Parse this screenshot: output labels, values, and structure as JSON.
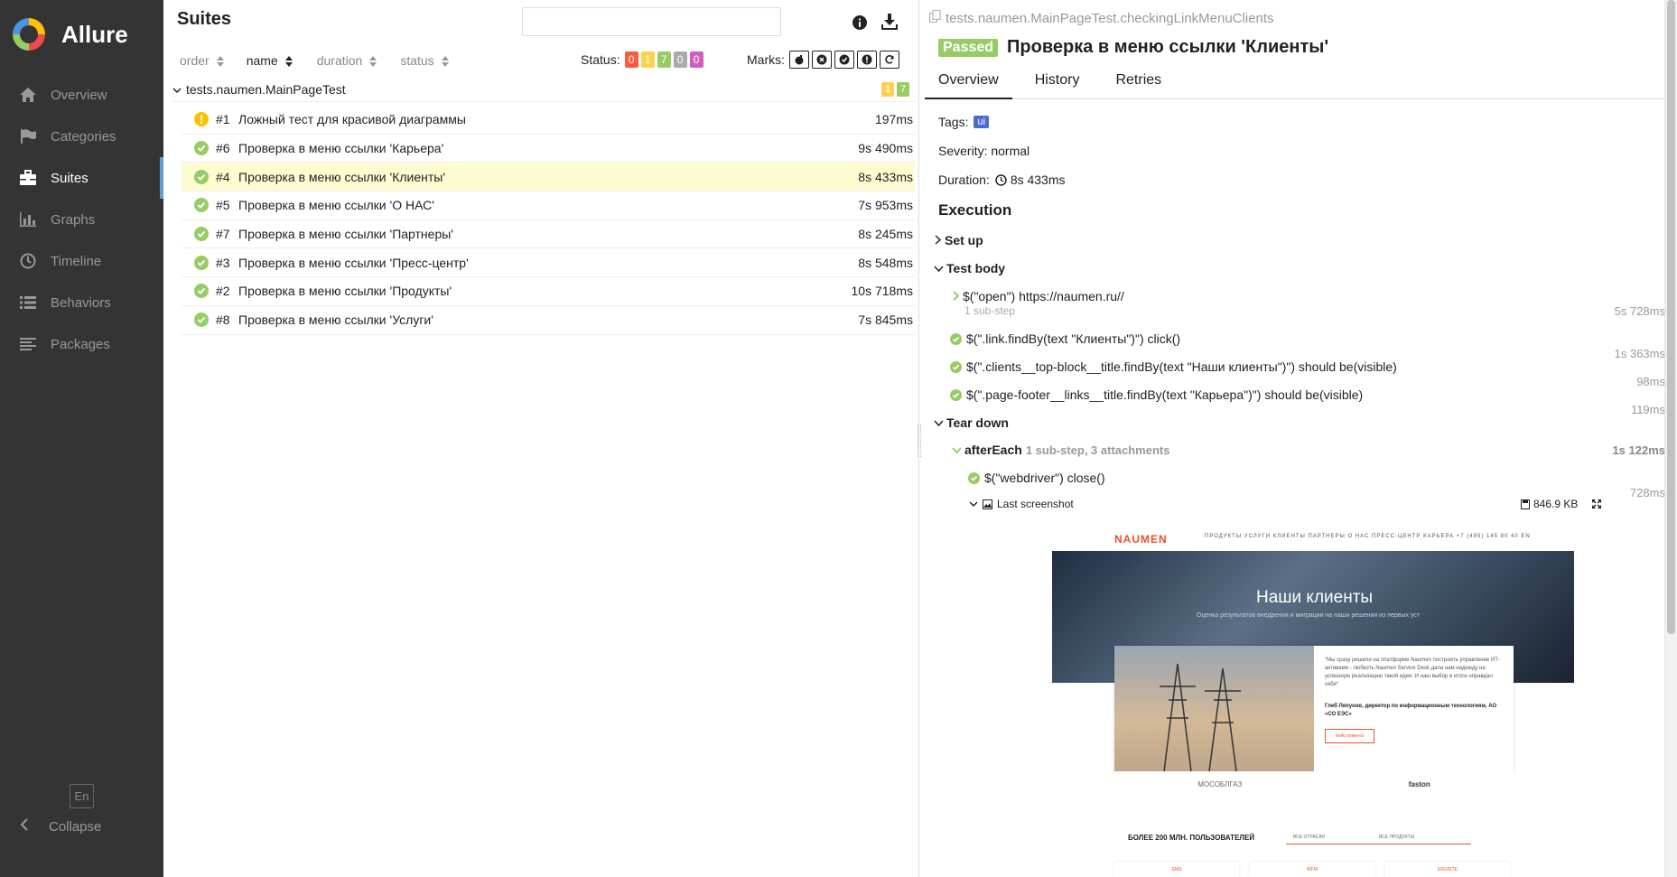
{
  "app": {
    "name": "Allure"
  },
  "sidebar": {
    "items": [
      {
        "label": "Overview",
        "icon": "home-icon",
        "active": false
      },
      {
        "label": "Categories",
        "icon": "flag-icon",
        "active": false
      },
      {
        "label": "Suites",
        "icon": "briefcase-icon",
        "active": true
      },
      {
        "label": "Graphs",
        "icon": "bar-chart-icon",
        "active": false
      },
      {
        "label": "Timeline",
        "icon": "clock-icon",
        "active": false
      },
      {
        "label": "Behaviors",
        "icon": "list-icon",
        "active": false
      },
      {
        "label": "Packages",
        "icon": "align-left-icon",
        "active": false
      }
    ],
    "language": "En",
    "collapse_label": "Collapse"
  },
  "suites": {
    "title": "Suites",
    "search": {
      "value": "",
      "placeholder": ""
    },
    "sort": {
      "order": "order",
      "name": "name",
      "duration": "duration",
      "status": "status"
    },
    "status_label": "Status:",
    "status_counts": [
      {
        "value": "0",
        "color": "#fd5a3e"
      },
      {
        "value": "1",
        "color": "#ffd050"
      },
      {
        "value": "7",
        "color": "#97cc64"
      },
      {
        "value": "0",
        "color": "#aaaaaa"
      },
      {
        "value": "0",
        "color": "#d35ebe"
      }
    ],
    "marks_label": "Marks:",
    "group": {
      "name": "tests.naumen.MainPageTest",
      "broken": "1",
      "passed": "7"
    },
    "tests": [
      {
        "num": "#1",
        "name": "Ложный тест для красивой диаграммы",
        "duration": "197ms",
        "status": "broken"
      },
      {
        "num": "#6",
        "name": "Проверка в меню ссылки 'Карьера'",
        "duration": "9s 490ms",
        "status": "passed"
      },
      {
        "num": "#4",
        "name": "Проверка в меню ссылки 'Клиенты'",
        "duration": "8s 433ms",
        "status": "passed",
        "selected": true
      },
      {
        "num": "#5",
        "name": "Проверка в меню ссылки 'О НАС'",
        "duration": "7s 953ms",
        "status": "passed"
      },
      {
        "num": "#7",
        "name": "Проверка в меню ссылки 'Партнеры'",
        "duration": "8s 245ms",
        "status": "passed"
      },
      {
        "num": "#3",
        "name": "Проверка в меню ссылки 'Пресс-центр'",
        "duration": "8s 548ms",
        "status": "passed"
      },
      {
        "num": "#2",
        "name": "Проверка в меню ссылки 'Продукты'",
        "duration": "10s 718ms",
        "status": "passed"
      },
      {
        "num": "#8",
        "name": "Проверка в меню ссылки 'Услуги'",
        "duration": "7s 845ms",
        "status": "passed"
      }
    ]
  },
  "details": {
    "full_name": "tests.naumen.MainPageTest.checkingLinkMenuClients",
    "status": "Passed",
    "title": "Проверка в меню ссылки 'Клиенты'",
    "tabs": [
      "Overview",
      "History",
      "Retries"
    ],
    "tags_label": "Tags:",
    "tag": "ui",
    "severity": "Severity: normal",
    "duration_label": "Duration:",
    "duration": "8s 433ms",
    "execution": "Execution",
    "setup": "Set up",
    "test_body": "Test body",
    "steps": [
      {
        "name": "$(\"open\") https://naumen.ru//",
        "sub": "1 sub-step",
        "time": "5s 728ms"
      },
      {
        "name": "$(\".link.findBy(text \"Клиенты\")\") click()",
        "time": "1s 363ms"
      },
      {
        "name": "$(\".clients__top-block__title.findBy(text \"Наши клиенты\")\") should be(visible)",
        "time": "98ms"
      },
      {
        "name": "$(\".page-footer__links__title.findBy(text \"Карьера\")\") should be(visible)",
        "time": "119ms"
      }
    ],
    "teardown": "Tear down",
    "after_each": {
      "name": "afterEach",
      "meta": "1 sub-step, 3 attachments",
      "time": "1s 122ms"
    },
    "webdriver_step": {
      "name": "$(\"webdriver\") close()",
      "time": "728ms"
    },
    "attachment": {
      "name": "Last screenshot",
      "size": "846.9 KB"
    }
  },
  "screenshot": {
    "logo": "NAUMEN",
    "menu": "ПРОДУКТЫ   УСЛУГИ   КЛИЕНТЫ   ПАРТНЕРЫ   О НАС   ПРЕСС-ЦЕНТР   КАРЬЕРА   +7 (495) 145 90 40   EN",
    "hero_title": "Наши клиенты",
    "hero_sub": "Оценка результатов внедрения и миграции на наши решения из первых уст",
    "quote": "\"Мы сразу решили на платформе Naumen построить управление ИТ-активами - любезть Naumen Service Desk дала нам надежду на успешную реализацию такой идеи. И наш выбор в итоге оправдал себя\"",
    "author": "Глеб Ляпунов, директор по информационным технологиям, АО «СО ЕЭС»",
    "button": "Кейс клиента",
    "logos": [
      "МОСОБЛГАЗ",
      "faston"
    ],
    "users_title": "БОЛЕЕ 200 МЛН. ПОЛЬЗОВАТЕЛЕЙ",
    "select_industry": "ВСЕ ОТРАСЛИ",
    "select_products": "ВСЕ ПРОДУКТЫ",
    "cards": [
      "EMS",
      "WFM",
      "ERUDITE"
    ]
  }
}
